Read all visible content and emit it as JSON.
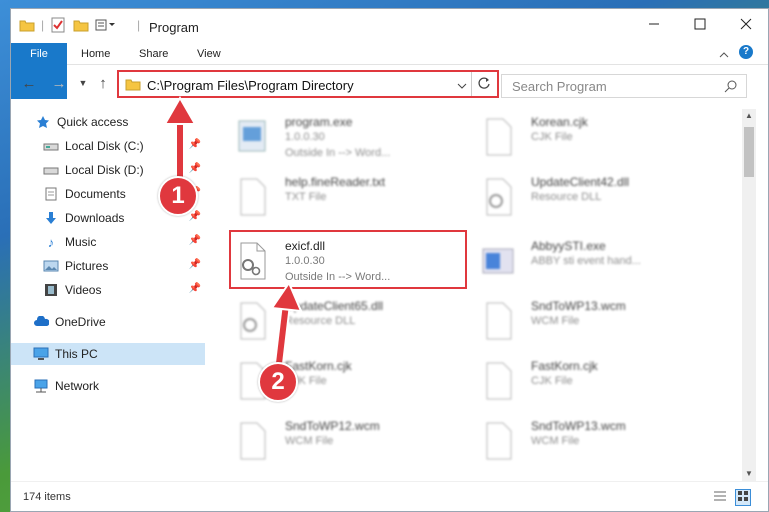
{
  "window": {
    "title": "Program"
  },
  "ribbon": {
    "tabs": [
      "File",
      "Home",
      "Share",
      "View"
    ]
  },
  "address": {
    "path": "C:\\Program Files\\Program Directory"
  },
  "search": {
    "placeholder": "Search Program"
  },
  "sidebar": {
    "items": [
      {
        "label": "Quick access",
        "icon": "star-icon",
        "pinned": false
      },
      {
        "label": "Local Disk (C:)",
        "icon": "drive-icon",
        "pinned": true
      },
      {
        "label": "Local Disk (D:)",
        "icon": "drive-icon",
        "pinned": true
      },
      {
        "label": "Documents",
        "icon": "documents-icon",
        "pinned": true
      },
      {
        "label": "Downloads",
        "icon": "download-icon",
        "pinned": true
      },
      {
        "label": "Music",
        "icon": "music-icon",
        "pinned": true
      },
      {
        "label": "Pictures",
        "icon": "pictures-icon",
        "pinned": true
      },
      {
        "label": "Videos",
        "icon": "videos-icon",
        "pinned": true
      },
      {
        "label": "OneDrive",
        "icon": "cloud-icon",
        "pinned": false
      },
      {
        "label": "This PC",
        "icon": "pc-icon",
        "pinned": false,
        "selected": true
      },
      {
        "label": "Network",
        "icon": "network-icon",
        "pinned": false
      }
    ]
  },
  "files": [
    {
      "name": "program.exe",
      "line2": "1.0.0.30",
      "line3": "Outside In --> Word..."
    },
    {
      "name": "Korean.cjk",
      "line2": "CJK File",
      "line3": ""
    },
    {
      "name": "help.fineReader.txt",
      "line2": "TXT File",
      "line3": ""
    },
    {
      "name": "UpdateClient42.dll",
      "line2": "Resource DLL",
      "line3": ""
    },
    {
      "name": "exicf.dll",
      "line2": "1.0.0.30",
      "line3": "Outside In --> Word..."
    },
    {
      "name": "AbbyySTI.exe",
      "line2": "ABBY sti event hand...",
      "line3": ""
    },
    {
      "name": "UpdateClient65.dll",
      "line2": "Resource DLL",
      "line3": ""
    },
    {
      "name": "SndToWP13.wcm",
      "line2": "WCM File",
      "line3": ""
    },
    {
      "name": "FastKorn.cjk",
      "line2": "CJK File",
      "line3": ""
    },
    {
      "name": "FastKorn.cjk",
      "line2": "CJK File",
      "line3": ""
    },
    {
      "name": "SndToWP12.wcm",
      "line2": "WCM File",
      "line3": ""
    },
    {
      "name": "SndToWP13.wcm",
      "line2": "WCM File",
      "line3": ""
    }
  ],
  "status": {
    "item_count": "174 items"
  },
  "callouts": [
    "1",
    "2"
  ]
}
